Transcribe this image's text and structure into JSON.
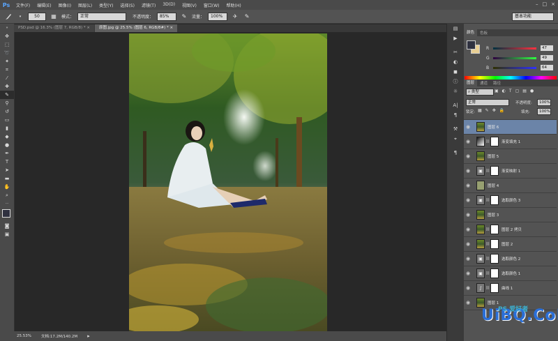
{
  "app": {
    "logo": "Ps"
  },
  "menu": [
    "文件(F)",
    "编辑(E)",
    "图像(I)",
    "图层(L)",
    "类型(Y)",
    "选择(S)",
    "滤镜(T)",
    "3D(D)",
    "视图(V)",
    "窗口(W)",
    "帮助(H)"
  ],
  "window_controls": [
    "–",
    "□",
    "×"
  ],
  "options": {
    "brush_size": "50",
    "mode_label": "模式：",
    "mode_value": "正常",
    "opacity_label": "不透明度：",
    "opacity_value": "85%",
    "flow_label": "流量：",
    "flow_value": "100%",
    "workspace": "基本功能"
  },
  "tabs": [
    {
      "label": "PSD.psd @ 16.3% (图层 7, RGB/8) * ×",
      "active": false
    },
    {
      "label": "原图.jpg @ 25.5% (图层 6, RGB/8#) * ×",
      "active": true
    }
  ],
  "status": {
    "zoom": "25.53%",
    "doc": "文档:17.2M/140.2M"
  },
  "color_panel": {
    "tabs": [
      "颜色",
      "色板"
    ],
    "r_label": "R",
    "r_value": "47",
    "g_label": "G",
    "g_value": "49",
    "b_label": "B",
    "b_value": "64",
    "fg_color": "#2f3140",
    "bg_color": "#e8cf94"
  },
  "layers_panel": {
    "tabs": [
      "图层",
      "通道",
      "路径"
    ],
    "kind_filter": "类型",
    "blend_mode": "正常",
    "opacity_label": "不透明度:",
    "opacity_value": "100%",
    "lock_label": "锁定:",
    "fill_label": "填充:",
    "fill_value": "100%",
    "layers": [
      {
        "name": "图层 6",
        "type": "photo",
        "mask": false,
        "selected": true
      },
      {
        "name": "渐变填充 1",
        "type": "gradient",
        "mask": true,
        "selected": false
      },
      {
        "name": "图层 5",
        "type": "photo",
        "mask": false,
        "selected": false
      },
      {
        "name": "渐变映射 1",
        "type": "adjust",
        "mask": true,
        "selected": false
      },
      {
        "name": "图层 4",
        "type": "solid",
        "mask": false,
        "selected": false
      },
      {
        "name": "选取颜色 3",
        "type": "adjust",
        "mask": true,
        "selected": false
      },
      {
        "name": "图层 3",
        "type": "photo",
        "mask": false,
        "selected": false
      },
      {
        "name": "图层 2 拷贝",
        "type": "photo",
        "mask": true,
        "selected": false
      },
      {
        "name": "图层 2",
        "type": "photo",
        "mask": true,
        "selected": false
      },
      {
        "name": "选取颜色 2",
        "type": "adjust",
        "mask": true,
        "selected": false
      },
      {
        "name": "选取颜色 1",
        "type": "adjust",
        "mask": true,
        "selected": false
      },
      {
        "name": "曲线 1",
        "type": "curves",
        "mask": true,
        "selected": false
      },
      {
        "name": "图层 1",
        "type": "photo",
        "mask": false,
        "selected": false
      }
    ]
  },
  "watermark": {
    "text": "UiBQ.CoM",
    "subtext": "PS 爱好者"
  }
}
